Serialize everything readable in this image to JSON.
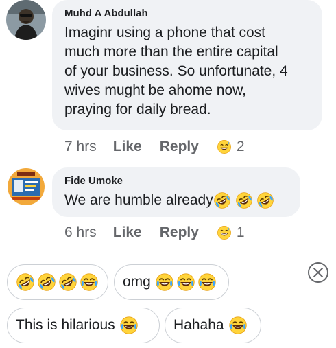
{
  "comments": [
    {
      "author": "Muhd A Abdullah",
      "lines": [
        "Imaginr using a phone that cost",
        "much more than the entire capital",
        "of your business. So unfortunate, 4",
        "wives mught be ahome now,",
        "praying for daily bread."
      ],
      "time": "7 hrs",
      "like_label": "Like",
      "reply_label": "Reply",
      "reaction_count": "2",
      "reaction_icon": "grinning-sweat-emoji-icon"
    },
    {
      "author": "Fide Umoke",
      "text": "We are humble already",
      "trailing_emojis": [
        "tears-of-joy-rolling",
        "tears-of-joy-rolling",
        "tears-of-joy-rolling"
      ],
      "time": "6 hrs",
      "like_label": "Like",
      "reply_label": "Reply",
      "reaction_count": "1",
      "reaction_icon": "grinning-sweat-emoji-icon"
    }
  ],
  "suggestions": [
    {
      "label": "",
      "emojis": [
        "rofl",
        "rofl",
        "rofl",
        "tears-of-joy"
      ]
    },
    {
      "label": "omg",
      "emojis": [
        "tears-of-joy",
        "tears-of-joy",
        "tears-of-joy"
      ]
    },
    {
      "label": "This is hilarious",
      "emojis": [
        "tears-of-joy"
      ]
    },
    {
      "label": "Hahaha",
      "emojis": [
        "tears-of-joy"
      ]
    }
  ],
  "colors": {
    "bubble": "#f0f2f5",
    "meta_text": "#65676b",
    "emoji_face": "#ffd43b",
    "emoji_outline": "#e8a317"
  }
}
